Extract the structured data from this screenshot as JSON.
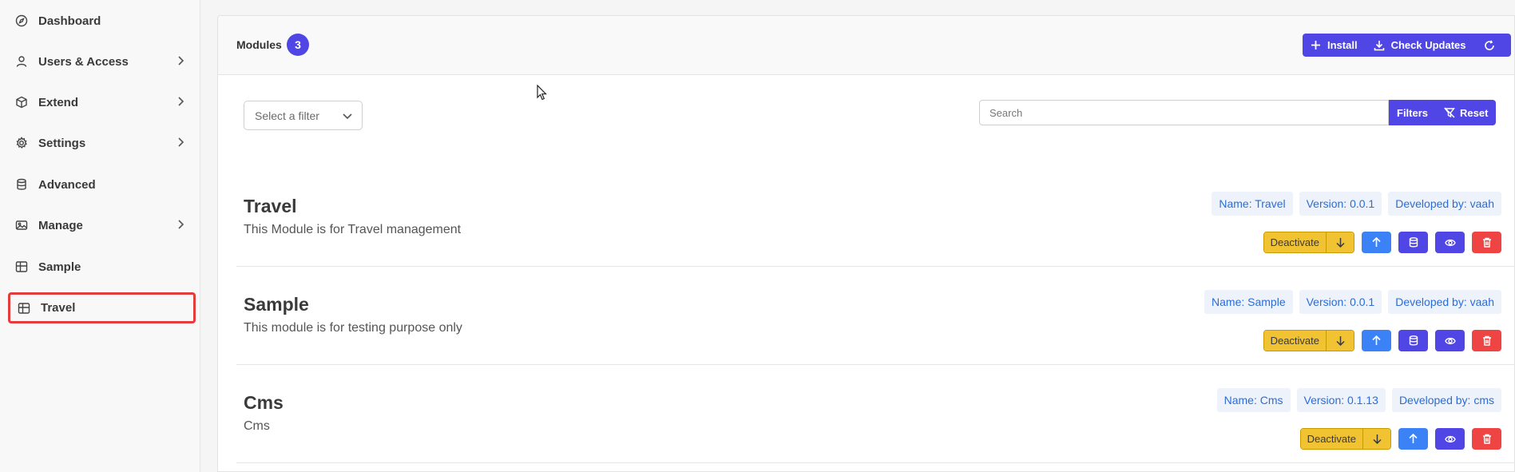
{
  "sidebar": {
    "items": [
      {
        "label": "Dashboard",
        "icon": "compass-icon",
        "has_chevron": false
      },
      {
        "label": "Users & Access",
        "icon": "user-icon",
        "has_chevron": true
      },
      {
        "label": "Extend",
        "icon": "cube-icon",
        "has_chevron": true
      },
      {
        "label": "Settings",
        "icon": "gear-icon",
        "has_chevron": true
      },
      {
        "label": "Advanced",
        "icon": "database-icon",
        "has_chevron": false
      },
      {
        "label": "Manage",
        "icon": "image-icon",
        "has_chevron": true
      },
      {
        "label": "Sample",
        "icon": "table-icon",
        "has_chevron": false
      },
      {
        "label": "Travel",
        "icon": "table-icon",
        "has_chevron": false,
        "active": true
      }
    ]
  },
  "header": {
    "title": "Modules",
    "count": "3",
    "install_label": "Install",
    "check_updates_label": "Check Updates"
  },
  "toolbar": {
    "filter_select_placeholder": "Select a filter",
    "search_placeholder": "Search",
    "filters_label": "Filters",
    "reset_label": "Reset"
  },
  "modules": [
    {
      "name": "Travel",
      "description": "This Module is for Travel management",
      "tag_name": "Name: Travel",
      "tag_version": "Version: 0.0.1",
      "tag_developer": "Developed by: vaah",
      "deactivate_label": "Deactivate",
      "has_database_button": true
    },
    {
      "name": "Sample",
      "description": "This module is for testing purpose only",
      "tag_name": "Name: Sample",
      "tag_version": "Version: 0.0.1",
      "tag_developer": "Developed by: vaah",
      "deactivate_label": "Deactivate",
      "has_database_button": true
    },
    {
      "name": "Cms",
      "description": "Cms",
      "tag_name": "Name: Cms",
      "tag_version": "Version: 0.1.13",
      "tag_developer": "Developed by: cms",
      "deactivate_label": "Deactivate",
      "has_database_button": false
    }
  ],
  "colors": {
    "primary": "#4f46e5",
    "blue": "#3b82f6",
    "warning": "#f1c232",
    "danger": "#ef4444",
    "active_outline": "#e23c3c",
    "tag_text": "#2b6cd6"
  }
}
